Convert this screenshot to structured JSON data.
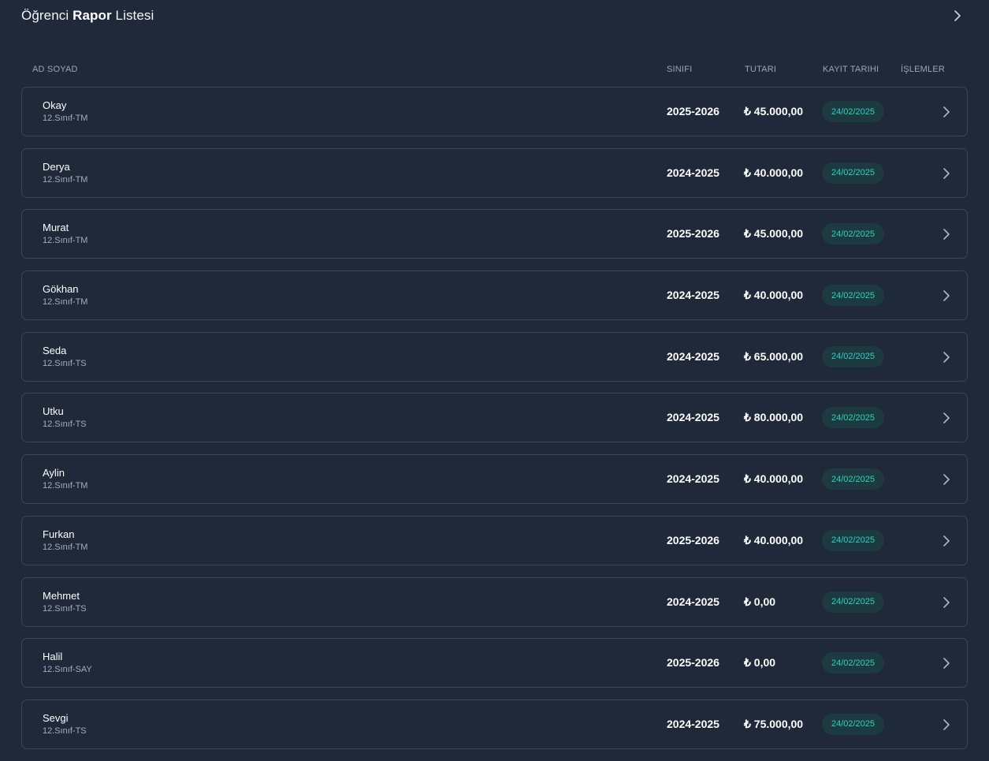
{
  "header": {
    "title_pre": "Öğrenci ",
    "title_bold": "Rapor",
    "title_post": " Listesi"
  },
  "columns": {
    "name": "AD SOYAD",
    "class": "SINIFI",
    "amount": "TUTARI",
    "date": "KAYIT TARIHI",
    "ops": "İŞLEMLER"
  },
  "colors": {
    "background": "#1f2939",
    "border": "#3a4557",
    "badge_bg": "#1c3a40",
    "badge_text": "#2dd4bf"
  },
  "rows": [
    {
      "name": "Okay",
      "sub": "12.Sınıf-TM",
      "cls": "2025-2026",
      "amt": "₺ 45.000,00",
      "date": "24/02/2025"
    },
    {
      "name": "Derya",
      "sub": "12.Sınıf-TM",
      "cls": "2024-2025",
      "amt": "₺ 40.000,00",
      "date": "24/02/2025"
    },
    {
      "name": "Murat",
      "sub": "12.Sınıf-TM",
      "cls": "2025-2026",
      "amt": "₺ 45.000,00",
      "date": "24/02/2025"
    },
    {
      "name": "Gökhan",
      "sub": "12.Sınıf-TM",
      "cls": "2024-2025",
      "amt": "₺ 40.000,00",
      "date": "24/02/2025"
    },
    {
      "name": "Seda",
      "sub": "12.Sınıf-TS",
      "cls": "2024-2025",
      "amt": "₺ 65.000,00",
      "date": "24/02/2025"
    },
    {
      "name": "Utku",
      "sub": "12.Sınıf-TS",
      "cls": "2024-2025",
      "amt": "₺ 80.000,00",
      "date": "24/02/2025"
    },
    {
      "name": "Aylin",
      "sub": "12.Sınıf-TM",
      "cls": "2024-2025",
      "amt": "₺ 40.000,00",
      "date": "24/02/2025"
    },
    {
      "name": "Furkan",
      "sub": "12.Sınıf-TM",
      "cls": "2025-2026",
      "amt": "₺ 40.000,00",
      "date": "24/02/2025"
    },
    {
      "name": "Mehmet",
      "sub": "12.Sınıf-TS",
      "cls": "2024-2025",
      "amt": "₺ 0,00",
      "date": "24/02/2025"
    },
    {
      "name": "Halil",
      "sub": "12.Sınıf-SAY",
      "cls": "2025-2026",
      "amt": "₺ 0,00",
      "date": "24/02/2025"
    },
    {
      "name": "Sevgi",
      "sub": "12.Sınıf-TS",
      "cls": "2024-2025",
      "amt": "₺ 75.000,00",
      "date": "24/02/2025"
    }
  ]
}
